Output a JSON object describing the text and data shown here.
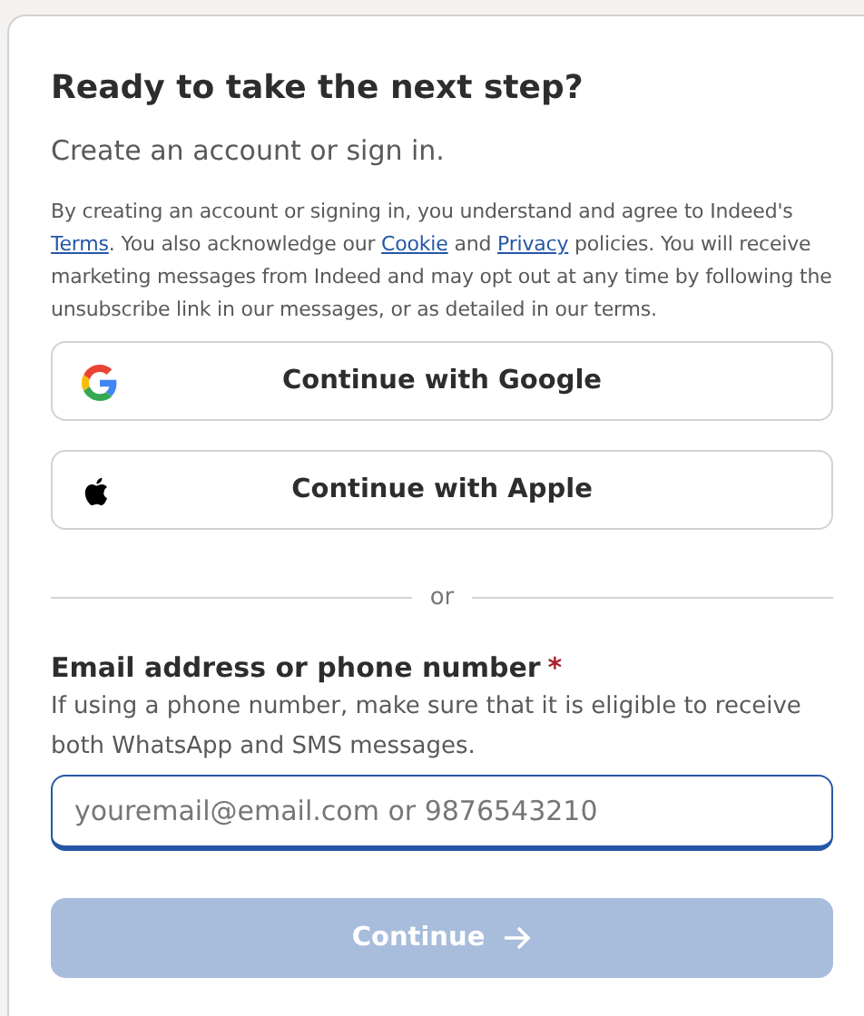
{
  "heading": "Ready to take the next step?",
  "subheading": "Create an account or sign in.",
  "consent": [
    {
      "kind": "text",
      "text": "By creating an account or signing in, you understand and agree to Indeed's "
    },
    {
      "kind": "link",
      "text": "Terms"
    },
    {
      "kind": "text",
      "text": ". You also acknowledge our "
    },
    {
      "kind": "link",
      "text": "Cookie"
    },
    {
      "kind": "text",
      "text": " and "
    },
    {
      "kind": "link",
      "text": "Privacy"
    },
    {
      "kind": "text",
      "text": " policies. You will receive marketing messages from Indeed and may opt out at any time by following the unsubscribe link in our messages, or as detailed in our terms."
    }
  ],
  "providers": [
    {
      "kind": "google",
      "label": "Continue with Google"
    },
    {
      "kind": "apple",
      "label": "Continue with Apple"
    }
  ],
  "divider": "or",
  "field": {
    "label": "Email address or phone number",
    "required_mark": "*",
    "hint": "If using a phone number, make sure that it is eligible to receive both WhatsApp and SMS messages.",
    "placeholder": "youremail@email.com or 9876543210",
    "focused": true
  },
  "submit": {
    "label": "Continue",
    "disabled": true
  }
}
